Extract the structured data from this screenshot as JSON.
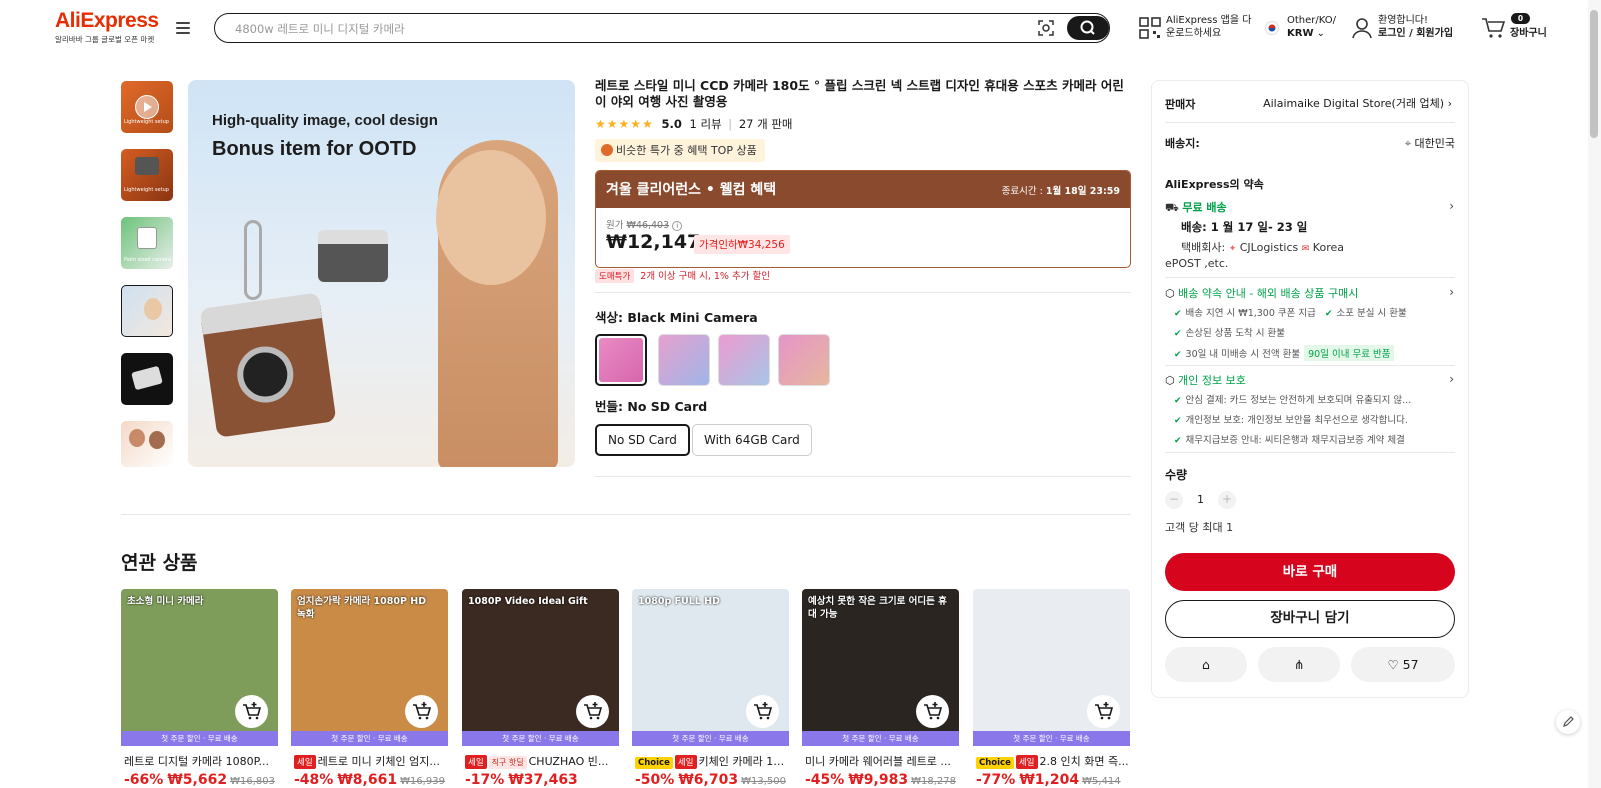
{
  "header": {
    "logo": "AliExpress",
    "logo_sub": "알리바바 그룹 글로벌 오픈 마켓",
    "search_placeholder": "4800w 레트로 미니 디지털 카메라",
    "app_line1": "AliExpress 앱을 다",
    "app_line2": "운로드하세요",
    "region_line1": "Other/KO/",
    "region_line2": "KRW",
    "account_line1": "환영합니다!",
    "account_line2": "로그인 / 회원가입",
    "cart_count": "0",
    "cart_label": "장바구니"
  },
  "product": {
    "title": "레트로 스타일 미니 CCD 카메라 180도 ° 플립 스크린 넥 스트랩 디자인 휴대용 스포츠 카메라 어린이 야외 여행 사진 촬영용",
    "rating_value": "5.0",
    "reviews": "1 리뷰",
    "sold": "27 개 판매",
    "top_badge": "비슷한 특가 중 혜택 TOP 상품",
    "image_text_1": "High-quality image, cool design",
    "image_text_2": "Bonus item for OOTD",
    "promo_title": "겨울 클리어런스 • 웰컴 혜택",
    "promo_end_label": "종료시간 :",
    "promo_end": "1월 18일 23:59",
    "original_label": "원가",
    "original_price": "₩46,403",
    "price": "₩12,147",
    "price_discount": "가격인하₩34,256",
    "bulk_tag": "도매특가",
    "bulk_text": "2개 이상 구매 시, 1% 추가 할인",
    "color_label": "색상:",
    "color_value": "Black Mini Camera",
    "bundle_label": "번들:",
    "bundle_value": "No SD Card",
    "bundle_options": [
      "No SD Card",
      "With 64GB Card"
    ],
    "thumbs": [
      "Lightweight setup",
      "Lightweight setup",
      "Palm sized camera",
      "",
      "",
      ""
    ]
  },
  "side": {
    "seller_label": "판매자",
    "seller_name": "Ailaimaike Digital Store(거래 업체)",
    "ship_label": "배송지:",
    "ship_to": "대한민국",
    "promise_title": "AliExpress의 약속",
    "free_ship": "무료 배송",
    "delivery": "배송: 1 월 17 일- 23 일",
    "courier_label": "택배회사:",
    "courier_1": "CJLogistics",
    "courier_2": "Korea",
    "courier_3": "ePOST ,etc.",
    "promise_link": "배송 약속 안내 - 해외 배송 상품 구매시",
    "promise_items": [
      "배송 지연 시 ₩1,300 쿠폰 지급",
      "소포 분실 시 환불",
      "손상된 상품 도착 시 환불",
      "30일 내 미배송 시 전액 환불"
    ],
    "return_tag": "90일 이내 무료 반품",
    "privacy_title": "개인 정보 보호",
    "privacy_items": [
      "안심 결제: 카드 정보는 안전하게 보호되며 유출되지 않...",
      "개인정보 보호: 개인정보 보안을 최우선으로 생각합니다.",
      "채무지급보증 안내: 씨티은행과 채무지급보증 계약 체결"
    ],
    "qty_label": "수량",
    "qty": "1",
    "qty_limit": "고객 당 최대 1",
    "buy_now": "바로 구매",
    "add_cart": "장바구니 담기",
    "likes": "57"
  },
  "related": {
    "title": "연관 상품",
    "strip": "첫 주문 할인 · 무료 배송",
    "items": [
      {
        "overlay": "초소형 미니 카메라",
        "tags": [],
        "name": "레트로 디지털 카메라 1080P...",
        "pct": "-66%",
        "price": "₩5,662",
        "old": "₩16,803",
        "bg": "#7f9d5a"
      },
      {
        "overlay": "엄지손가락 카메라 1080P HD 녹화",
        "tags": [
          "세일"
        ],
        "name": "레트로 미니 키체인 엄지...",
        "pct": "-48%",
        "price": "₩8,661",
        "old": "₩16,939",
        "bg": "#c98b45"
      },
      {
        "overlay": "1080P Video Ideal Gift",
        "tags": [
          "세일",
          "직구 핫딜"
        ],
        "name": "CHUZHAO 빈...",
        "pct": "-17%",
        "price": "₩37,463",
        "old": "",
        "bg": "#3b2a22"
      },
      {
        "overlay": "1080p FULL HD",
        "tags": [
          "Choice",
          "세일"
        ],
        "name": "키체인 카메라 10...",
        "pct": "-50%",
        "price": "₩6,703",
        "old": "₩13,500",
        "bg": "#dfe8ef"
      },
      {
        "overlay": "예상치 못한 작은 크기로 어디든 휴대 가능",
        "tags": [],
        "name": "미니 카메라 웨어러블 레트로 ...",
        "pct": "-45%",
        "price": "₩9,983",
        "old": "₩18,278",
        "bg": "#2a2520"
      },
      {
        "overlay": "",
        "tags": [
          "Choice",
          "세일"
        ],
        "name": "2.8 인치 화면 즉...",
        "pct": "-77%",
        "price": "₩1,204",
        "old": "₩5,414",
        "bg": "#e9ecf1"
      }
    ]
  }
}
